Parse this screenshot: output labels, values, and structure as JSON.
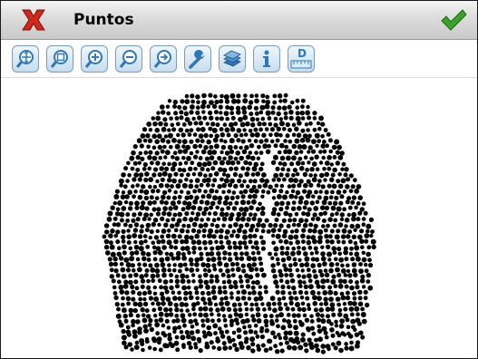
{
  "window": {
    "title": "Puntos",
    "close_icon": "red-x-icon",
    "ok_icon": "green-check-icon"
  },
  "toolbar": {
    "buttons": [
      {
        "name": "zoom-extents-icon"
      },
      {
        "name": "zoom-window-icon"
      },
      {
        "name": "zoom-in-icon"
      },
      {
        "name": "zoom-out-icon"
      },
      {
        "name": "zoom-previous-icon"
      },
      {
        "name": "settings-wrench-icon"
      },
      {
        "name": "layers-icon"
      },
      {
        "name": "info-icon"
      },
      {
        "name": "distance-measure-icon",
        "label": "D"
      }
    ]
  },
  "colors": {
    "close_red": "#d0281c",
    "ok_green": "#3aa32a",
    "button_blue": "#2f77b8",
    "points": "#000000"
  },
  "point_cloud": {
    "description_hidden": true
  }
}
